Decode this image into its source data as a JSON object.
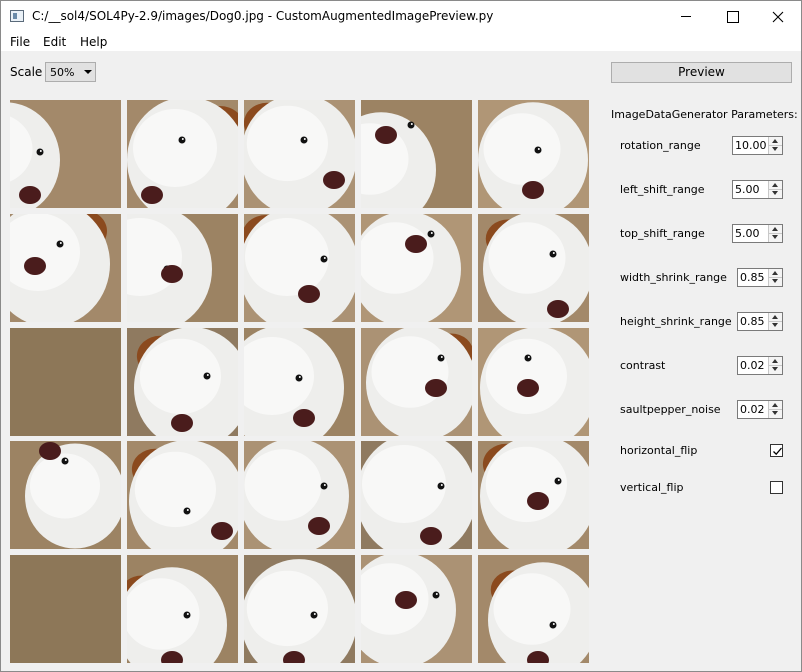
{
  "window": {
    "title": "C:/__sol4/SOL4Py-2.9/images/Dog0.jpg - CustomAugmentedImagePreview.py"
  },
  "menu": [
    "File",
    "Edit",
    "Help"
  ],
  "toolbar": {
    "scale_label": "Scale",
    "scale_value": "50%",
    "preview_label": "Preview"
  },
  "params": {
    "title": "ImageDataGenerator Parameters:",
    "spinners": [
      {
        "label": "rotation_range",
        "value": "10.00"
      },
      {
        "label": "left_shift_range",
        "value": "5.00"
      },
      {
        "label": "top_shift_range",
        "value": "5.00"
      },
      {
        "label": "width_shrink_range",
        "value": "0.85"
      },
      {
        "label": "height_shrink_range",
        "value": "0.85"
      },
      {
        "label": "contrast",
        "value": "0.02"
      },
      {
        "label": "saultpepper_noise",
        "value": "0.02"
      }
    ],
    "checks": [
      {
        "label": "horizontal_flip",
        "checked": true
      },
      {
        "label": "vertical_flip",
        "checked": false
      }
    ]
  },
  "colors": {
    "background": "#f0f0f0",
    "titlebar": "#ffffff",
    "photo_backdrop": "#a58c6b",
    "fur": "#eeeeec",
    "nose": "#4a1c1c",
    "ear": "#8b4a1e"
  },
  "grid": {
    "rows": 5,
    "cols": 5
  }
}
